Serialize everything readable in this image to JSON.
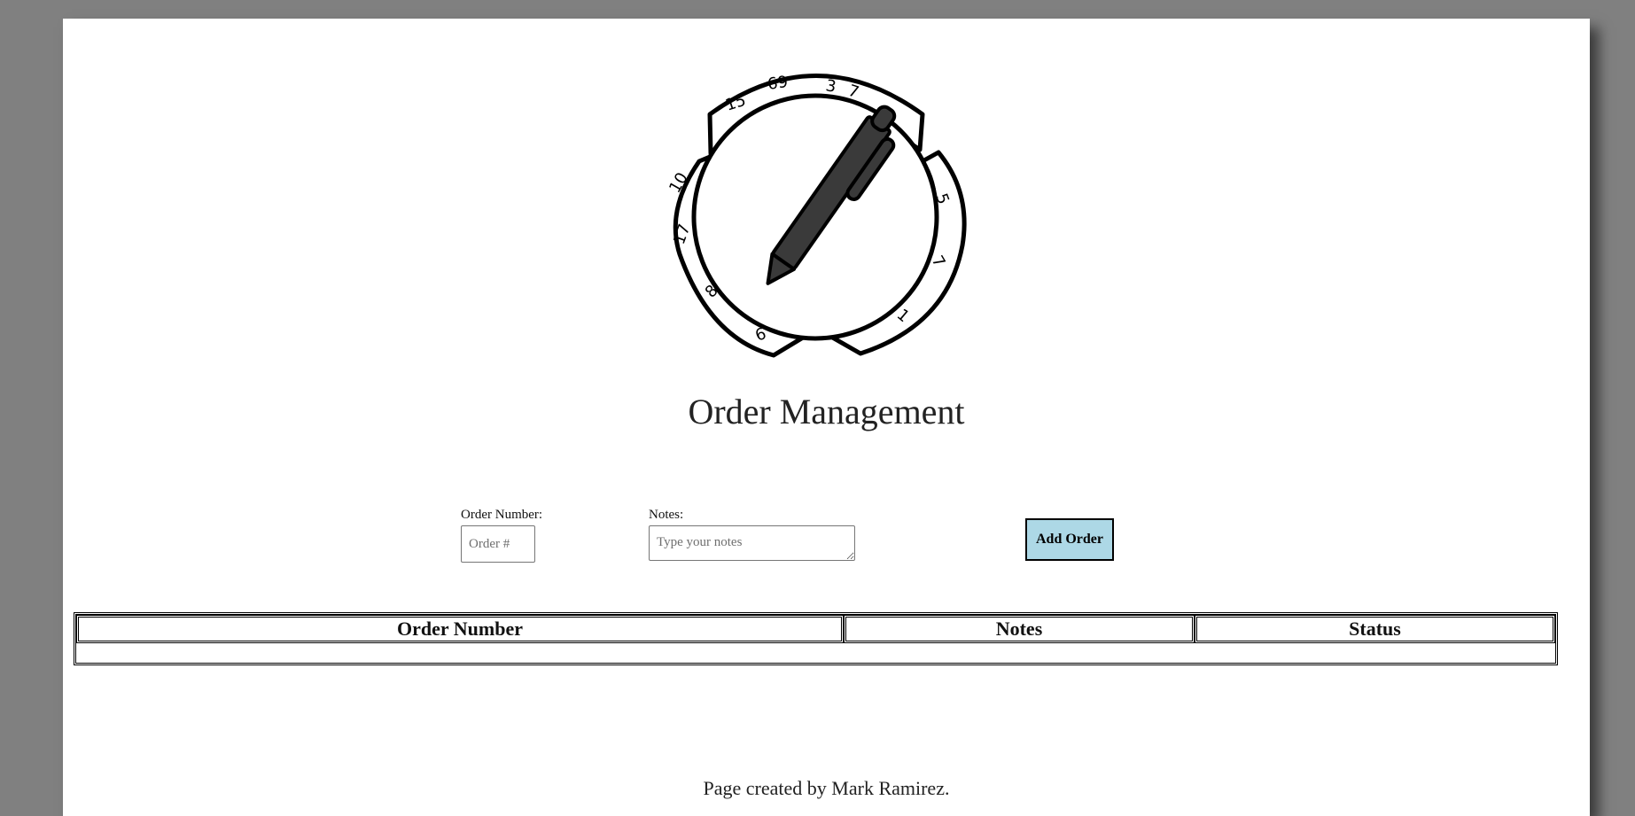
{
  "logo": {
    "icon": "pen-and-ticket-logo",
    "numbers": [
      "15",
      "69",
      "3",
      "7",
      "10",
      "17",
      "8",
      "6",
      "5",
      "7",
      "1"
    ]
  },
  "header": {
    "title": "Order Management"
  },
  "form": {
    "order_label": "Order Number:",
    "order_placeholder": "Order #",
    "notes_label": "Notes:",
    "notes_placeholder": "Type your notes",
    "add_button_label": "Add Order"
  },
  "table": {
    "columns": [
      "Order Number",
      "Notes",
      "Status"
    ],
    "rows": []
  },
  "footer": {
    "text": "Page created by Mark Ramirez."
  },
  "colors": {
    "background": "#808080",
    "page": "#ffffff",
    "button": "#add8e6",
    "logo_pen": "#3a3a3a"
  }
}
